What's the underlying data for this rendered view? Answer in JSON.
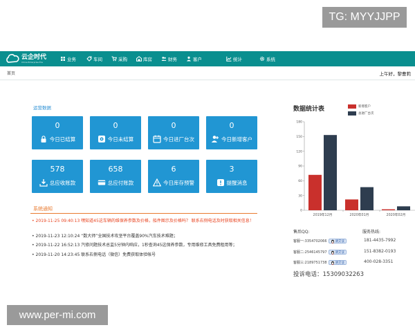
{
  "watermark": {
    "top": "TG: MYYJJPP",
    "bottom": "www.per-mi.com"
  },
  "logo": {
    "cn": "云企时代",
    "en": "China Enterprise Era"
  },
  "nav": [
    {
      "label": "业务",
      "icon": "grid-icon"
    },
    {
      "label": "车间",
      "icon": "tag-icon"
    },
    {
      "label": "采购",
      "icon": "cart-icon"
    },
    {
      "label": "库房",
      "icon": "warehouse-icon"
    },
    {
      "label": "财务",
      "icon": "users-icon"
    },
    {
      "label": "客户",
      "icon": "person-icon"
    },
    {
      "label": "统计",
      "icon": "chart-line-icon"
    },
    {
      "label": "系统",
      "icon": "gear-icon"
    }
  ],
  "breadcrumb": "首页",
  "greeting": "上午好，黎曹莉",
  "ops_title": "运营数据",
  "tiles": [
    {
      "value": "0",
      "label": "今日已结算",
      "icon": "lock-icon"
    },
    {
      "value": "0",
      "label": "今日未结算",
      "icon": "unlock-icon"
    },
    {
      "value": "0",
      "label": "今日进厂台次",
      "icon": "calendar-icon"
    },
    {
      "value": "0",
      "label": "今日新增客户",
      "icon": "add-user-icon"
    },
    {
      "value": "578",
      "label": "总应收账款",
      "icon": "download-icon"
    },
    {
      "value": "658",
      "label": "总应付账款",
      "icon": "card-icon"
    },
    {
      "value": "6",
      "label": "今日库存预警",
      "icon": "warning-icon"
    },
    {
      "value": "3",
      "label": "提醒消息",
      "icon": "alert-icon"
    }
  ],
  "notice_title": "系统通知",
  "notices": [
    {
      "text": "2019-11-25 09:40:13 嘿知道45这车辆的维保养参数及价格，船件图示及价格吗？ 联系右侧电话及时获取相关信息！",
      "highlight": true
    },
    {
      "text": "2019-11-23 12:10:24 “数大师”全国技术攻坚平台覆盖90%汽车技术难题；",
      "highlight": false
    },
    {
      "text": "2019-11-22 16:52:13 汽修问题技术总监5分钟内响应，1秒查询45这保养参数，专用维修工具免费租用等；",
      "highlight": false
    },
    {
      "text": "2019-11-20 14:23:45 联系右侧电话（微信）免费获取体验帐号",
      "highlight": false
    }
  ],
  "colors": {
    "nav": "#0a8f8f",
    "tile": "#2196d3",
    "series_new": "#c9302c",
    "series_in": "#2e3d4f",
    "notice": "#e8792e"
  },
  "chart_data": {
    "type": "bar",
    "title": "数据统计表",
    "categories": [
      "2019年12月",
      "2020年01月",
      "2020年02月"
    ],
    "series": [
      {
        "name": "新增客户",
        "values": [
          72,
          22,
          2
        ]
      },
      {
        "name": "总进厂台次",
        "values": [
          153,
          47,
          8
        ]
      }
    ],
    "ylim": [
      0,
      180
    ],
    "yticks": [
      0,
      30,
      60,
      90,
      120,
      150,
      180
    ],
    "grid": false,
    "legend": "top"
  },
  "contacts": {
    "qq_title": "售后QQ:",
    "hotline_title": "服务热线:",
    "qq": [
      {
        "label": "客服一:3354702066",
        "badge": "请交谈"
      },
      {
        "label": "客服二:2546145797",
        "badge": "请交谈"
      },
      {
        "label": "客服三:2189751738",
        "badge": "请交谈"
      }
    ],
    "hotlines": [
      "181-4435-7992",
      "151-8382-0193",
      "400-028-3351"
    ],
    "complaint": "投诉电话：15309032263"
  }
}
